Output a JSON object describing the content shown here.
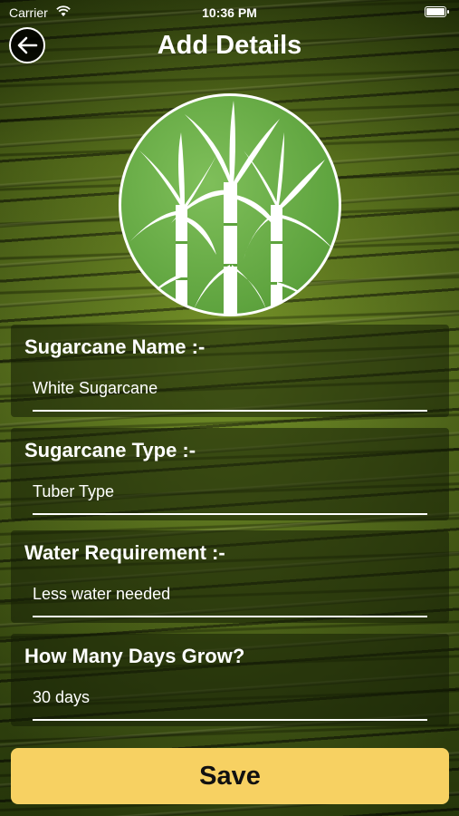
{
  "status_bar": {
    "carrier": "Carrier",
    "time": "10:36 PM"
  },
  "header": {
    "title": "Add Details",
    "back_icon": "arrow-left-icon"
  },
  "logo": {
    "icon": "sugarcane-icon",
    "background_color": "#5ea33e"
  },
  "form": {
    "fields": [
      {
        "label": "Sugarcane Name :-",
        "value": "White Sugarcane"
      },
      {
        "label": "Sugarcane Type :-",
        "value": "Tuber Type"
      },
      {
        "label": "Water Requirement :-",
        "value": "Less water needed"
      },
      {
        "label": "How Many Days Grow?",
        "value": "30 days"
      }
    ]
  },
  "save_button": {
    "label": "Save",
    "color": "#f7d162"
  }
}
